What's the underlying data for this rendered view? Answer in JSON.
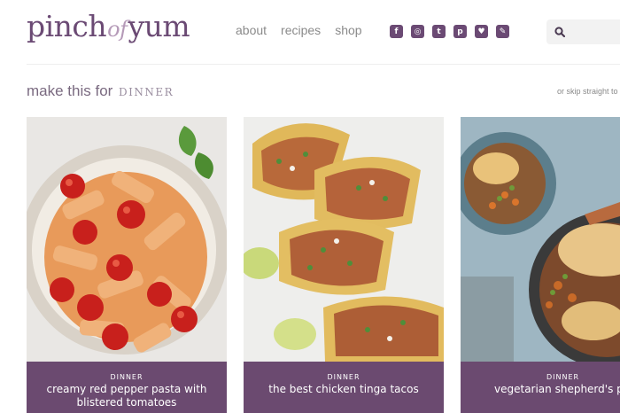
{
  "header": {
    "logo_left": "pinch",
    "logo_mid": "of",
    "logo_right": "yum",
    "nav": [
      {
        "label": "about"
      },
      {
        "label": "recipes"
      },
      {
        "label": "shop"
      }
    ],
    "social": [
      {
        "icon": "facebook-icon",
        "glyph": "f"
      },
      {
        "icon": "instagram-icon",
        "glyph": "◎"
      },
      {
        "icon": "twitter-icon",
        "glyph": "t"
      },
      {
        "icon": "pinterest-icon",
        "glyph": "p"
      },
      {
        "icon": "heart-icon",
        "glyph": "♥"
      },
      {
        "icon": "feed-icon",
        "glyph": "✎"
      }
    ],
    "search": {
      "placeholder": "",
      "value": ""
    }
  },
  "section": {
    "lead": "make this for",
    "meal": "DINNER",
    "skip": "or skip straight to"
  },
  "cards": [
    {
      "category": "DINNER",
      "title": "creamy red pepper pasta with blistered tomatoes"
    },
    {
      "category": "DINNER",
      "title": "the best chicken tinga tacos"
    },
    {
      "category": "DINNER",
      "title": "vegetarian shepherd's pi"
    }
  ],
  "colors": {
    "brand": "#6b4a74",
    "caption_bg": "#6b4a70",
    "nav_text": "#8a8a8a"
  }
}
